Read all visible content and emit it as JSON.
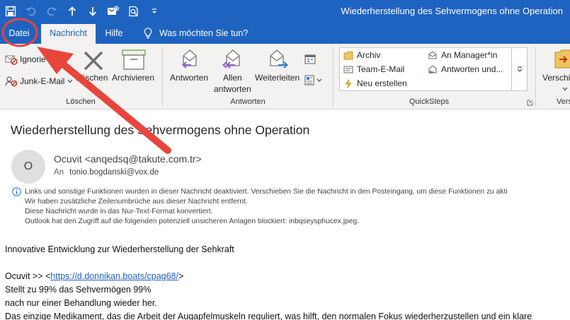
{
  "window": {
    "title": "Wiederherstellung des Sehvermogens ohne Operation"
  },
  "qat": {
    "icons": [
      "save-icon",
      "undo-icon",
      "redo-icon",
      "up-arrow-icon",
      "down-arrow-icon",
      "sync-icon",
      "print-preview-icon",
      "customize-qat-icon"
    ]
  },
  "tabs": {
    "datei": "Datei",
    "nachricht": "Nachricht",
    "hilfe": "Hilfe",
    "tellme": "Was möchten Sie tun?"
  },
  "ribbon": {
    "loeschen_group": {
      "label": "Löschen",
      "ignore": "Ignorie",
      "junk": "Junk-E-Mail",
      "delete": "Löschen",
      "archive": "Archivieren"
    },
    "antworten_group": {
      "label": "Antworten",
      "reply": "Antworten",
      "reply_all_line1": "Allen",
      "reply_all_line2": "antworten",
      "forward": "Weiterleiten"
    },
    "quicksteps_group": {
      "label": "QuickSteps",
      "items": [
        "Archiv",
        "Team-E-Mail",
        "Neu erstellen",
        "An Manager*in",
        "Antworten und..."
      ]
    },
    "move_group": {
      "label": "Vers",
      "button": "Verschi"
    }
  },
  "message": {
    "subject": "Wiederherstellung des Sehvermogens ohne Operation",
    "avatar_initial": "O",
    "sender": "Ocuvit <anqedsq@takute.com.tr>",
    "to_label": "An",
    "to_value": "tonio.bogdanski@vox.de",
    "info_lines": [
      "Links und sonstige Funktionen wurden in dieser Nachricht deaktiviert. Verschieben Sie die Nachricht in den Posteingang, um diese Funktionen zu akti",
      "Wir haben zusätzliche Zeilenumbrüche aus dieser Nachricht entfernt.",
      "Diese Nachricht wurde in das Nur-Text-Format konvertiert.",
      "Outlook hat den Zugriff auf die folgenden potenziell unsicheren Anlagen blockiert: inbqseysphucex.jpeg."
    ],
    "body": {
      "line1": "Innovative Entwicklung zur Wiederherstellung der Sehkraft",
      "line2_prefix": "Ocuvit >> <",
      "line2_link": "https://d.donnikan.boats/cpag68/",
      "line2_suffix": ">",
      "line3": "Stellt zu 99% das Sehvermögen 99%",
      "line4": "nach nur einer Behandlung wieder her.",
      "line5": "Das einzige Medikament, das die Arbeit der Augapfelmuskeln reguliert, was hilft, den normalen Fokus wiederherzustellen und ein klare"
    }
  },
  "annotation": {
    "color": "#e8453c"
  }
}
